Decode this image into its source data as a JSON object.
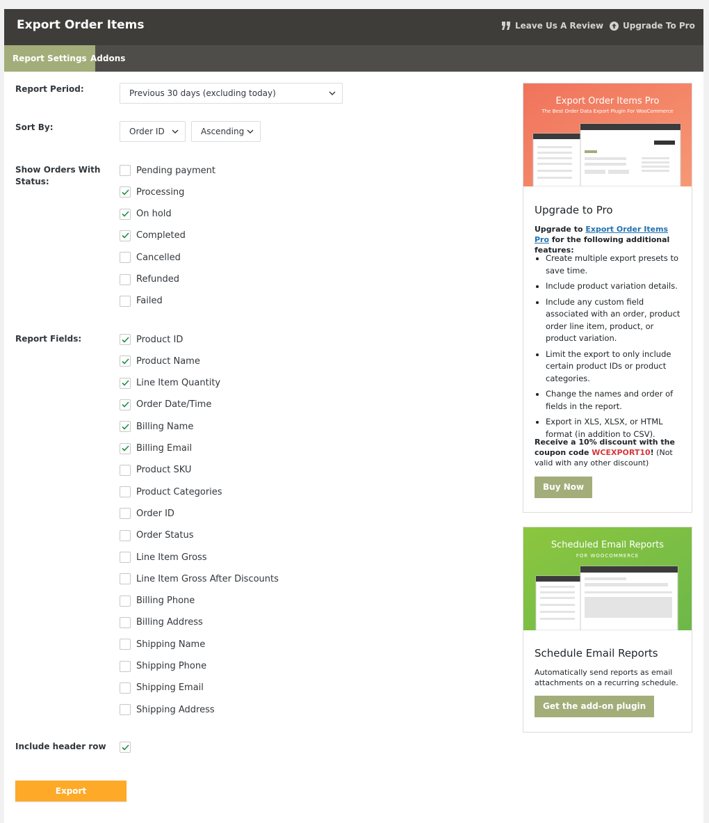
{
  "header": {
    "title": "Export Order Items",
    "review_label": "Leave Us A Review",
    "upgrade_label": "Upgrade To Pro"
  },
  "tabs": [
    {
      "label": "Report Settings",
      "active": true
    },
    {
      "label": "Addons",
      "active": false
    }
  ],
  "form": {
    "report_period": {
      "label": "Report Period:",
      "value": "Previous 30 days (excluding today)"
    },
    "sort_by": {
      "label": "Sort By:",
      "field": "Order ID",
      "direction": "Ascending"
    },
    "status": {
      "label_line1": "Show Orders With",
      "label_line2": "Status:",
      "options": [
        {
          "label": "Pending payment",
          "checked": false
        },
        {
          "label": "Processing",
          "checked": true
        },
        {
          "label": "On hold",
          "checked": true
        },
        {
          "label": "Completed",
          "checked": true
        },
        {
          "label": "Cancelled",
          "checked": false
        },
        {
          "label": "Refunded",
          "checked": false
        },
        {
          "label": "Failed",
          "checked": false
        }
      ]
    },
    "fields": {
      "label": "Report Fields:",
      "options": [
        {
          "label": "Product ID",
          "checked": true
        },
        {
          "label": "Product Name",
          "checked": true
        },
        {
          "label": "Line Item Quantity",
          "checked": true
        },
        {
          "label": "Order Date/Time",
          "checked": true
        },
        {
          "label": "Billing Name",
          "checked": true
        },
        {
          "label": "Billing Email",
          "checked": true
        },
        {
          "label": "Product SKU",
          "checked": false
        },
        {
          "label": "Product Categories",
          "checked": false
        },
        {
          "label": "Order ID",
          "checked": false
        },
        {
          "label": "Order Status",
          "checked": false
        },
        {
          "label": "Line Item Gross",
          "checked": false
        },
        {
          "label": "Line Item Gross After Discounts",
          "checked": false
        },
        {
          "label": "Billing Phone",
          "checked": false
        },
        {
          "label": "Billing Address",
          "checked": false
        },
        {
          "label": "Shipping Name",
          "checked": false
        },
        {
          "label": "Shipping Phone",
          "checked": false
        },
        {
          "label": "Shipping Email",
          "checked": false
        },
        {
          "label": "Shipping Address",
          "checked": false
        }
      ]
    },
    "header_row": {
      "label": "Include header row",
      "checked": true
    },
    "export_label": "Export"
  },
  "promo_pro": {
    "image_title": "Export Order Items Pro",
    "image_subtitle": "The Best Order Data Export Plugin For WooCommerce",
    "heading": "Upgrade to Pro",
    "intro_before": "Upgrade to ",
    "intro_link": "Export Order Items Pro",
    "intro_after": " for the following additional features:",
    "features": [
      "Create multiple export presets to save time.",
      "Include product variation details.",
      "Include any custom field associated with an order, product order line item, product, or product variation.",
      "Limit the export to only include certain product IDs or product categories.",
      "Change the names and order of fields in the report.",
      "Export in XLS, XLSX, or HTML format (in addition to CSV)."
    ],
    "discount_before": "Receive a 10% discount with the coupon code ",
    "coupon": "WCEXPORT10",
    "discount_bang": "!",
    "discount_after": " (Not valid with any other discount)",
    "button": "Buy Now"
  },
  "promo_email": {
    "image_title": "Scheduled Email Reports",
    "image_subtitle": "FOR WOOCOMMERCE",
    "heading": "Schedule Email Reports",
    "description": "Automatically send reports as email attachments on a recurring schedule.",
    "button": "Get the add-on plugin"
  },
  "colors": {
    "topbar": "#3e3d3a",
    "tabbar": "#4f4d4a",
    "accent_green": "#a2ad7a",
    "export_orange": "#ffa928",
    "check_green": "#1e8c45",
    "coupon_red": "#d63638"
  },
  "icons": {
    "review": "quote-icon",
    "upgrade": "arrow-up-circle-icon",
    "dropdown": "chevron-down-icon",
    "check": "checkmark-icon"
  }
}
